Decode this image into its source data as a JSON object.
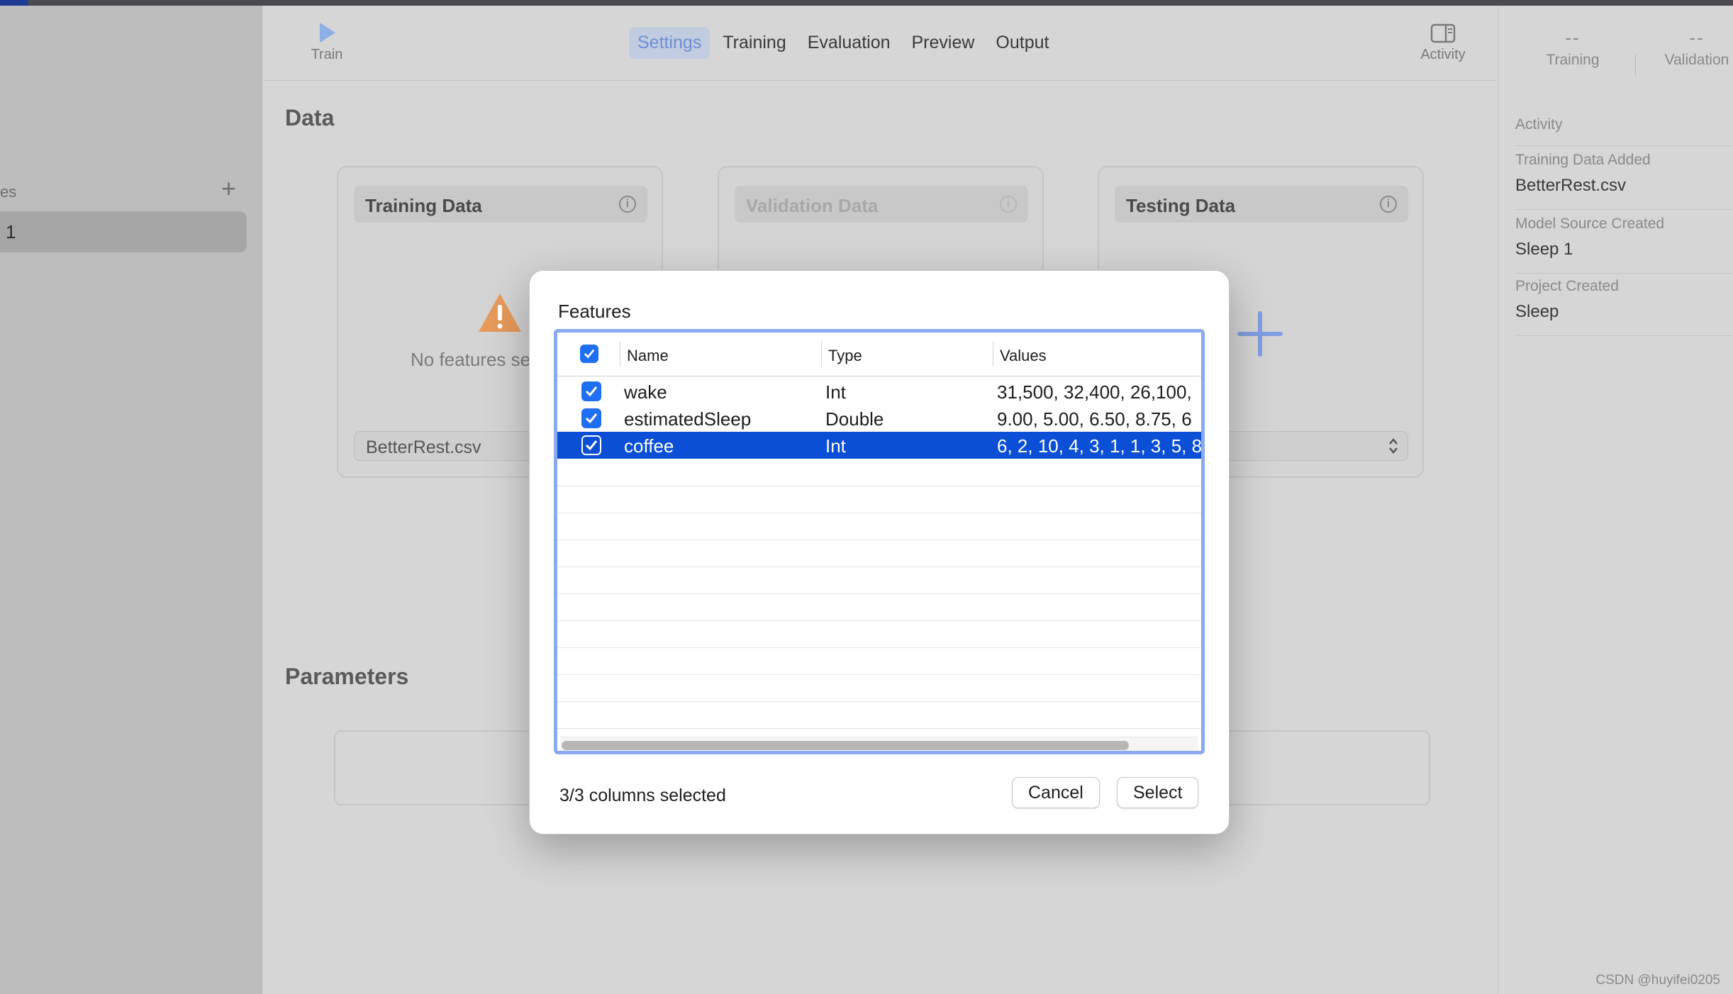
{
  "sidebar": {
    "section_label": "es",
    "add_symbol": "+",
    "selected_item": "1"
  },
  "toolbar": {
    "train_label": "Train",
    "activity_label": "Activity",
    "tabs": [
      {
        "label": "Settings",
        "active": true
      },
      {
        "label": "Training",
        "active": false
      },
      {
        "label": "Evaluation",
        "active": false
      },
      {
        "label": "Preview",
        "active": false
      },
      {
        "label": "Output",
        "active": false
      }
    ]
  },
  "main": {
    "data_heading": "Data",
    "parameters_heading": "Parameters",
    "cards": [
      {
        "title": "Training Data",
        "warning": "No features se",
        "file": "BetterRest.csv",
        "enabled": true
      },
      {
        "title": "Validation Data",
        "enabled": false
      },
      {
        "title": "Testing Data",
        "enabled": true
      }
    ]
  },
  "inspector": {
    "training_value": "--",
    "training_label": "Training",
    "validation_value": "--",
    "validation_label": "Validation",
    "activity_heading": "Activity",
    "events": [
      {
        "label": "Training Data Added",
        "value": "BetterRest.csv"
      },
      {
        "label": "Model Source Created",
        "value": "Sleep 1"
      },
      {
        "label": "Project Created",
        "value": "Sleep"
      }
    ]
  },
  "dialog": {
    "title": "Features",
    "columns": {
      "name": "Name",
      "type": "Type",
      "values": "Values"
    },
    "rows": [
      {
        "name": "wake",
        "type": "Int",
        "values": "31,500, 32,400, 26,100,",
        "checked": true,
        "selected": false
      },
      {
        "name": "estimatedSleep",
        "type": "Double",
        "values": "9.00, 5.00, 6.50, 8.75, 6",
        "checked": true,
        "selected": false
      },
      {
        "name": "coffee",
        "type": "Int",
        "values": "6, 2, 10, 4, 3, 1, 1, 3, 5, 8",
        "checked": true,
        "selected": true
      }
    ],
    "status": "3/3 columns selected",
    "cancel_label": "Cancel",
    "select_label": "Select"
  },
  "watermark": "CSDN @huyifei0205",
  "colors": {
    "accent": "#1f6ff5",
    "selection": "#0a4fd6",
    "focus_ring": "#8aaaf0"
  }
}
